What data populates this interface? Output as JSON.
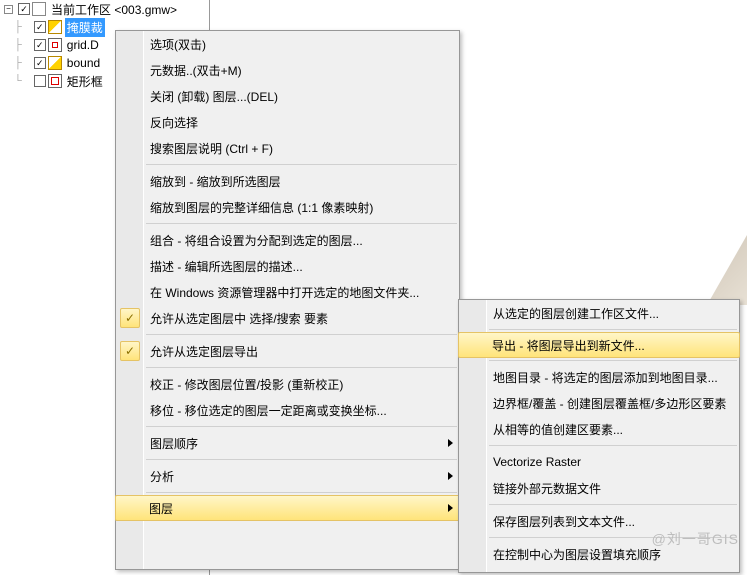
{
  "tree": {
    "root_label": "当前工作区  <003.gmw>",
    "items": [
      {
        "label": "掩膜裁",
        "icon": "ico-mask",
        "checked": true,
        "selected": true
      },
      {
        "label": "grid.D",
        "icon": "ico-grid",
        "checked": true,
        "selected": false
      },
      {
        "label": "bound",
        "icon": "ico-bound",
        "checked": true,
        "selected": false
      },
      {
        "label": "矩形框",
        "icon": "ico-rect",
        "checked": false,
        "selected": false
      }
    ]
  },
  "menu1": [
    {
      "t": "item",
      "label": "选项(双击)"
    },
    {
      "t": "item",
      "label": "元数据..(双击+M)"
    },
    {
      "t": "item",
      "label": "关闭 (卸载) 图层...(DEL)"
    },
    {
      "t": "item",
      "label": "反向选择"
    },
    {
      "t": "item",
      "label": "搜索图层说明 (Ctrl + F)"
    },
    {
      "t": "sep"
    },
    {
      "t": "item",
      "label": "缩放到 - 缩放到所选图层"
    },
    {
      "t": "item",
      "label": "缩放到图层的完整详细信息 (1:1 像素映射)"
    },
    {
      "t": "sep"
    },
    {
      "t": "item",
      "label": "组合 - 将组合设置为分配到选定的图层..."
    },
    {
      "t": "item",
      "label": "描述 - 编辑所选图层的描述..."
    },
    {
      "t": "item",
      "label": "在 Windows 资源管理器中打开选定的地图文件夹..."
    },
    {
      "t": "item",
      "label": "允许从选定图层中 选择/搜索 要素",
      "checked": true
    },
    {
      "t": "sep"
    },
    {
      "t": "item",
      "label": "允许从选定图层导出",
      "checked": true
    },
    {
      "t": "sep"
    },
    {
      "t": "item",
      "label": "校正 - 修改图层位置/投影 (重新校正)"
    },
    {
      "t": "item",
      "label": "移位 - 移位选定的图层一定距离或变换坐标..."
    },
    {
      "t": "sep"
    },
    {
      "t": "item",
      "label": "图层顺序",
      "arrow": true
    },
    {
      "t": "sep"
    },
    {
      "t": "item",
      "label": "分析",
      "arrow": true
    },
    {
      "t": "sep"
    },
    {
      "t": "item",
      "label": "图层",
      "arrow": true,
      "hover": true
    }
  ],
  "menu2": [
    {
      "t": "item",
      "label": "从选定的图层创建工作区文件..."
    },
    {
      "t": "sep"
    },
    {
      "t": "item",
      "label": "导出 - 将图层导出到新文件...",
      "hover": true
    },
    {
      "t": "sep"
    },
    {
      "t": "item",
      "label": "地图目录 - 将选定的图层添加到地图目录..."
    },
    {
      "t": "item",
      "label": "边界框/覆盖 - 创建图层覆盖框/多边形区要素"
    },
    {
      "t": "item",
      "label": "从相等的值创建区要素..."
    },
    {
      "t": "sep"
    },
    {
      "t": "item",
      "label": "Vectorize Raster"
    },
    {
      "t": "item",
      "label": "链接外部元数据文件"
    },
    {
      "t": "sep"
    },
    {
      "t": "item",
      "label": "保存图层列表到文本文件..."
    },
    {
      "t": "sep"
    },
    {
      "t": "item",
      "label": "在控制中心为图层设置填充顺序"
    }
  ],
  "watermark": "@刘一哥GIS"
}
